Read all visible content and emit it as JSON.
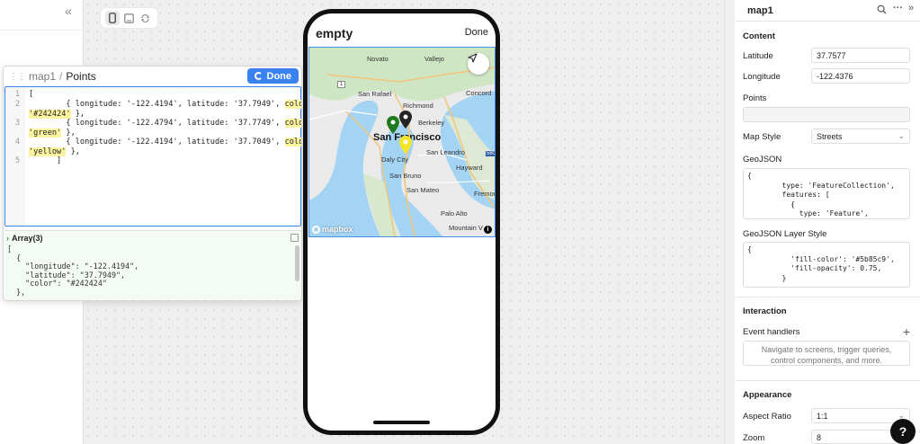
{
  "nav": {
    "collapse_glyph": "«"
  },
  "device_toolbar": {
    "icons": [
      "phone-icon",
      "tablet-icon",
      "rotate-icon"
    ]
  },
  "editor": {
    "breadcrumb_component": "map1",
    "breadcrumb_sep": "/",
    "breadcrumb_field": "Points",
    "done_label": "Done",
    "line_numbers": [
      "1",
      "2",
      "3",
      "4",
      "5"
    ],
    "code_lines": [
      [
        "[",
        "",
        ""
      ],
      [
        "        { longitude: '-122.4194', latitude: '37.7949', ",
        "color:",
        ""
      ],
      [
        "'#242424'",
        " },",
        ""
      ],
      [
        "        { longitude: '-122.4794', latitude: '37.7749', ",
        "color:",
        ""
      ],
      [
        "'green'",
        " },",
        ""
      ],
      [
        "        { longitude: '-122.4194', latitude: '37.7049', ",
        "color:  ",
        ""
      ],
      [
        "'yellow'",
        " },",
        ""
      ],
      [
        "      ]",
        "",
        ""
      ]
    ],
    "result_title": "Array(3)",
    "result_lines": [
      "[",
      "  {",
      "    \"longitude\": \"-122.4194\",",
      "    \"latitude\": \"37.7949\",",
      "    \"color\": \"#242424\"",
      "  },"
    ]
  },
  "phone": {
    "title": "empty",
    "done_label": "Done",
    "map_labels": {
      "novato": "Novato",
      "vallejo": "Vallejo",
      "concord": "Concord",
      "san_rafael": "San Rafael",
      "richmond": "Richmond",
      "berkeley": "Berkeley",
      "san_francisco": "San Francisco",
      "daly_city": "Daly City",
      "san_leandro": "San Leandro",
      "hayward": "Hayward",
      "san_bruno": "San Bruno",
      "san_mateo": "San Mateo",
      "fremont": "Fremon",
      "palo_alto": "Palo Alto",
      "mountain_view": "Mountain V",
      "highway_1": "1",
      "highway_580": "580"
    },
    "mapbox_label": "mapbox",
    "info_label": "i"
  },
  "inspector": {
    "component_name": "map1",
    "content_title": "Content",
    "latitude_label": "Latitude",
    "latitude_value": "37.7577",
    "longitude_label": "Longitude",
    "longitude_value": "-122.4376",
    "points_label": "Points",
    "points_value": "",
    "map_style_label": "Map Style",
    "map_style_value": "Streets",
    "geojson_label": "GeoJSON",
    "geojson_text": "{\n        type: 'FeatureCollection',\n        features: [\n          {\n            type: 'Feature',",
    "geojson_layer_label": "GeoJSON Layer Style",
    "geojson_layer_text": "{\n          'fill-color': '#5b85c9',\n          'fill-opacity': 0.75,\n        }",
    "interaction_title": "Interaction",
    "event_handlers_label": "Event handlers",
    "event_handlers_placeholder": "Navigate to screens, trigger queries, control components, and more.",
    "appearance_title": "Appearance",
    "aspect_ratio_label": "Aspect Ratio",
    "aspect_ratio_value": "1:1",
    "zoom_label": "Zoom",
    "zoom_value": "8",
    "help_label": "?"
  },
  "colors": {
    "accent": "#3a82f0",
    "pin_dark": "#242424",
    "pin_green": "#1f7a1f",
    "pin_yellow": "#f5e52a"
  }
}
